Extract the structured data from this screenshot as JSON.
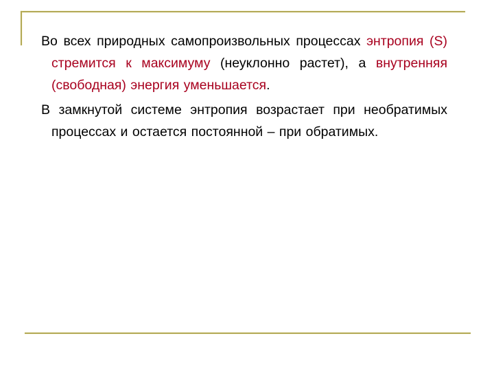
{
  "slide": {
    "accent_color": "#b3a956",
    "highlight_color": "#a8001e",
    "paragraphs": [
      {
        "segments": [
          {
            "text": "Во всех природных самопроизвольных процессах ",
            "highlight": false
          },
          {
            "text": "энтропия (S) стремится к максимуму",
            "highlight": true
          },
          {
            "text": " (неуклонно растет), а ",
            "highlight": false
          },
          {
            "text": "внутренняя (свободная) энергия уменьшается",
            "highlight": true
          },
          {
            "text": ".",
            "highlight": false
          }
        ]
      },
      {
        "segments": [
          {
            "text": "В замкнутой системе энтропия возрастает при необратимых процессах и остается постоянной – при обратимых.",
            "highlight": false
          }
        ]
      }
    ]
  }
}
